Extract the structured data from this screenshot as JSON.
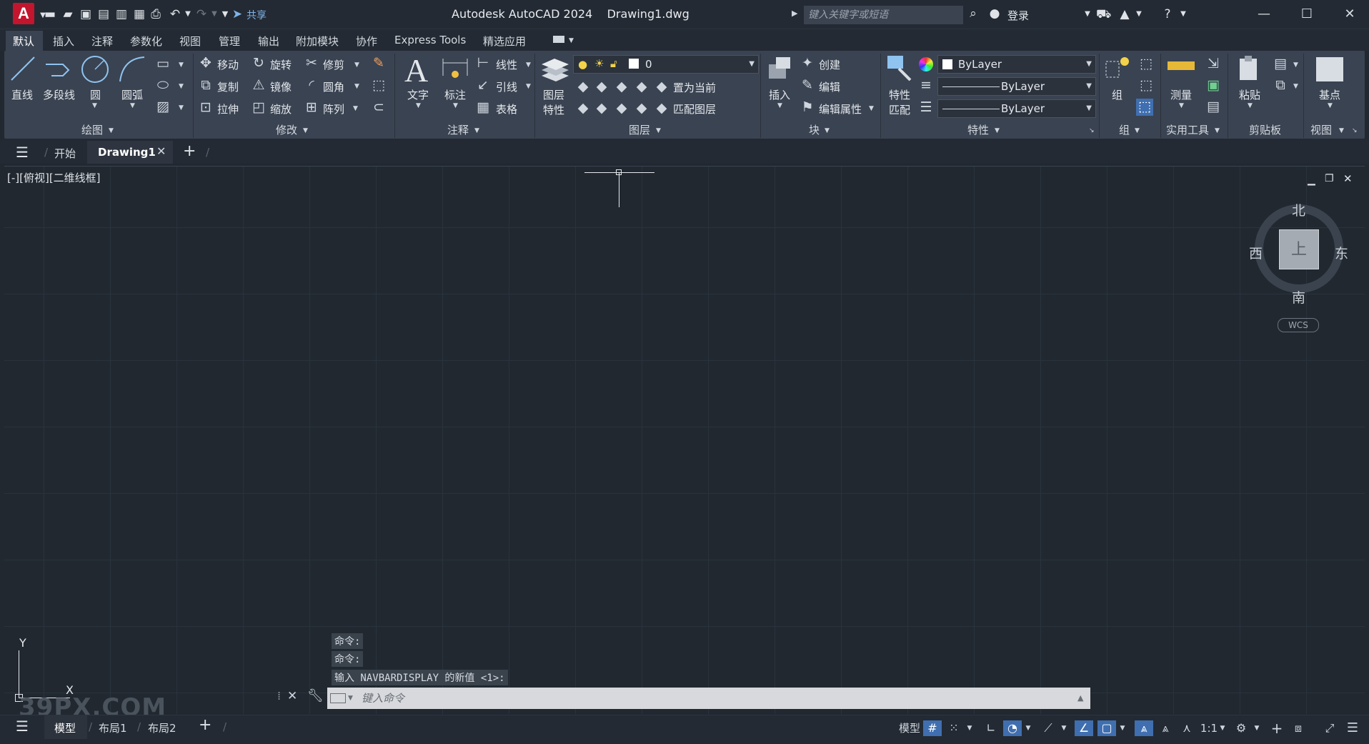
{
  "app": {
    "logo": "A",
    "title": "Autodesk AutoCAD 2024    Drawing1.dwg",
    "search_placeholder": "键入关键字或短语",
    "login": "登录",
    "share": "共享"
  },
  "ribbon_tabs": [
    "默认",
    "插入",
    "注释",
    "参数化",
    "视图",
    "管理",
    "输出",
    "附加模块",
    "协作",
    "Express Tools",
    "精选应用"
  ],
  "ribbon": {
    "draw": {
      "title": "绘图",
      "line": "直线",
      "polyline": "多段线",
      "circle": "圆",
      "arc": "圆弧"
    },
    "modify": {
      "title": "修改",
      "move": "移动",
      "rotate": "旋转",
      "trim": "修剪",
      "copy": "复制",
      "mirror": "镜像",
      "fillet": "圆角",
      "stretch": "拉伸",
      "scale": "缩放",
      "array": "阵列"
    },
    "annotation": {
      "title": "注释",
      "text": "文字",
      "dimension": "标注",
      "linear": "线性",
      "leader": "引线",
      "table": "表格"
    },
    "layers": {
      "title": "图层",
      "properties_1": "图层",
      "properties_2": "特性",
      "current_layer": "0",
      "make_current": "置为当前",
      "match_layer": "匹配图层"
    },
    "block": {
      "title": "块",
      "insert": "插入",
      "create": "创建",
      "edit": "编辑",
      "edit_attributes": "编辑属性"
    },
    "properties": {
      "title": "特性",
      "match_1": "特性",
      "match_2": "匹配",
      "color": "ByLayer",
      "linetype": "ByLayer",
      "lineweight": "ByLayer"
    },
    "groups": {
      "title": "组",
      "group": "组"
    },
    "utilities": {
      "title": "实用工具",
      "measure": "测量"
    },
    "clipboard": {
      "title": "剪贴板",
      "paste": "粘贴"
    },
    "view": {
      "title": "视图",
      "base": "基点"
    }
  },
  "file_tabs": {
    "start": "开始",
    "drawing": "Drawing1"
  },
  "viewport": {
    "label": "[-][俯视][二维线框]",
    "viewcube": {
      "face": "上",
      "north": "北",
      "south": "南",
      "east": "东",
      "west": "西",
      "wcs": "WCS"
    },
    "ucs_x": "X",
    "ucs_y": "Y"
  },
  "command": {
    "history": [
      "命令:",
      "命令:",
      "输入 NAVBARDISPLAY 的新值 <1>:"
    ],
    "placeholder": "键入命令"
  },
  "layout_tabs": [
    "模型",
    "布局1",
    "布局2"
  ],
  "status": {
    "model": "模型",
    "scale": "1:1"
  },
  "watermark": "39PX.COM"
}
